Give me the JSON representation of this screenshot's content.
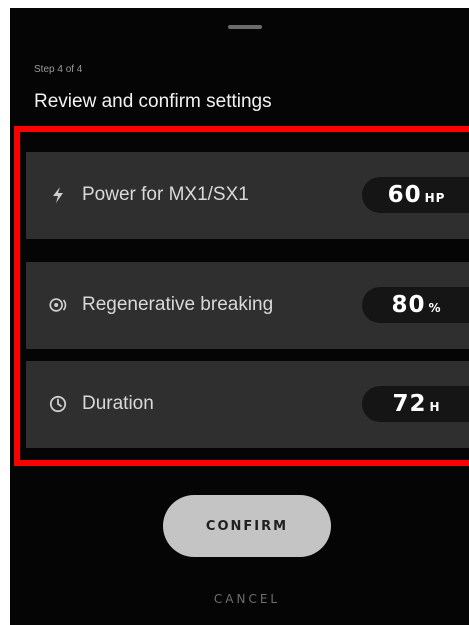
{
  "sheet": {
    "step_text": "Step 4 of 4",
    "title": "Review and confirm settings"
  },
  "settings": [
    {
      "icon": "lightning-icon",
      "label": "Power for MX1/SX1",
      "value": "60",
      "unit": "HP"
    },
    {
      "icon": "regen-icon",
      "label": "Regenerative breaking",
      "value": "80",
      "unit": "%"
    },
    {
      "icon": "clock-icon",
      "label": "Duration",
      "value": "72",
      "unit": "H"
    }
  ],
  "actions": {
    "confirm_label": "CONFIRM",
    "cancel_label": "CANCEL"
  },
  "colors": {
    "background": "#050505",
    "row": "#2f2f2f",
    "pill": "#151515",
    "confirm_button": "#c4c4c4",
    "highlight": "#ff0000"
  }
}
